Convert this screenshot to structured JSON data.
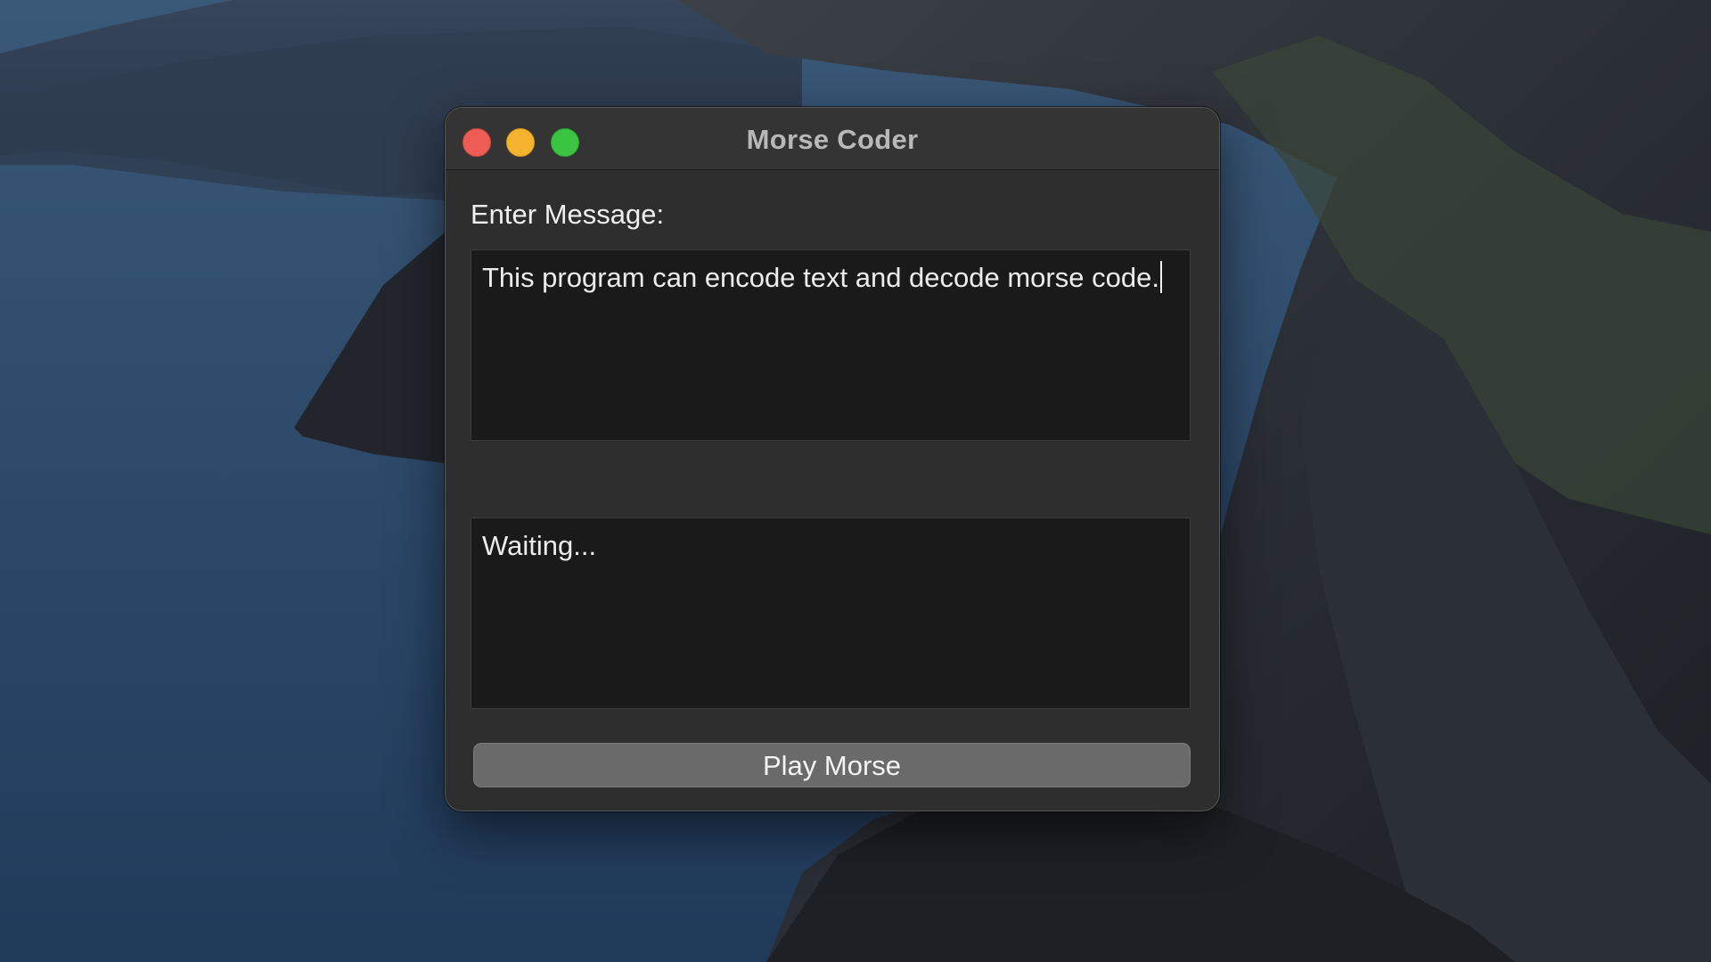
{
  "window": {
    "title": "Morse Coder"
  },
  "input": {
    "label": "Enter Message:",
    "value": "This program can encode text and decode morse code."
  },
  "output": {
    "value": "Waiting..."
  },
  "actions": {
    "play_label": "Play Morse"
  },
  "colors": {
    "close": "#ee5d55",
    "minimize": "#f4b32f",
    "zoom": "#3bc441",
    "window_bg": "#2e2e2e",
    "textbox_bg": "#1a1a1a",
    "button_bg": "#6a6a6a"
  }
}
